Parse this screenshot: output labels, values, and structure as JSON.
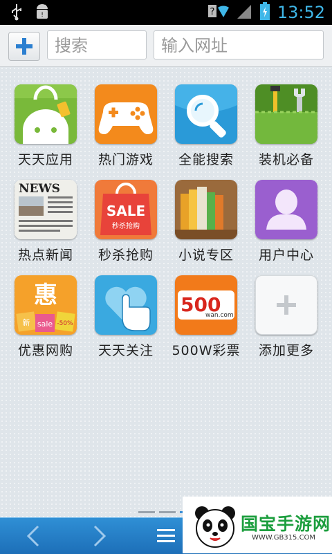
{
  "status_bar": {
    "time": "13:52",
    "icons": [
      "usb-icon",
      "android-debug-icon",
      "wifi-icon",
      "signal-icon",
      "battery-icon"
    ]
  },
  "toolbar": {
    "add_icon": "plus-icon",
    "search_placeholder": "搜索",
    "url_placeholder": "输入网址"
  },
  "apps": [
    {
      "label": "天天应用",
      "icon": "shopping-bag-android-icon"
    },
    {
      "label": "热门游戏",
      "icon": "gamepad-icon"
    },
    {
      "label": "全能搜索",
      "icon": "magnifier-icon"
    },
    {
      "label": "装机必备",
      "icon": "toolkit-icon"
    },
    {
      "label": "热点新闻",
      "icon": "newspaper-icon",
      "icon_text": "NEWS"
    },
    {
      "label": "秒杀抢购",
      "icon": "sale-bag-icon",
      "icon_text": "SALE",
      "icon_subtext": "秒杀抢购"
    },
    {
      "label": "小说专区",
      "icon": "books-icon"
    },
    {
      "label": "用户中心",
      "icon": "user-silhouette-icon"
    },
    {
      "label": "优惠网购",
      "icon": "discount-bags-icon",
      "icon_text": "惠",
      "icon_tags": [
        "新",
        "sale",
        "-50%"
      ]
    },
    {
      "label": "天天关注",
      "icon": "heart-finger-icon"
    },
    {
      "label": "500W彩票",
      "icon": "lottery-500-icon",
      "icon_text": "500",
      "icon_subtext": "wan.com"
    },
    {
      "label": "添加更多",
      "icon": "add-more-icon"
    }
  ],
  "bottom_bar": {
    "back_icon": "chevron-left-icon",
    "forward_icon": "chevron-right-icon",
    "menu_icon": "menu-icon"
  },
  "watermark": {
    "text": "国宝手游网",
    "url": "WWW.GB315.COM"
  }
}
